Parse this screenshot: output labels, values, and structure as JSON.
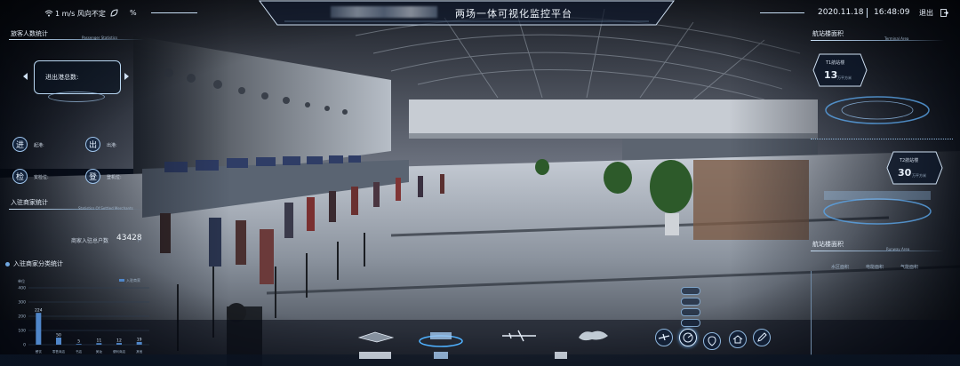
{
  "header": {
    "weather_wind": "1 m/s 风向不定",
    "humidity_unit": "%",
    "title": "两场一体可视化监控平台",
    "date": "2020.11.18",
    "time": "16:48:09",
    "logout_label": "退出"
  },
  "left_panel": {
    "passenger_stats": {
      "title": "旅客人数统计",
      "subtitle": "Passenger Statistics",
      "total_label": "进出港总数:",
      "rows": [
        {
          "icon_char": "进",
          "label": "起港:"
        },
        {
          "icon_char": "出",
          "label": "出港:"
        },
        {
          "icon_char": "检",
          "label": "安检位:"
        },
        {
          "icon_char": "登",
          "label": "登机位:"
        }
      ]
    },
    "merchant_stats": {
      "title": "入驻商家统计",
      "subtitle": "Statistics Of Settled Merchants",
      "count_label": "商家入驻总户数",
      "count_value": "43428",
      "count_unit": "户"
    },
    "merchant_category": {
      "title": "入驻商家分类统计",
      "legend_label": "入驻商家",
      "chart_data": {
        "type": "bar",
        "ylabel": "单位",
        "yticks": [
          400,
          300,
          200,
          100,
          0
        ],
        "ylim": [
          0,
          400
        ],
        "categories": [
          "餐饮",
          "零售商店",
          "书店",
          "美妆",
          "便利商店",
          "其他"
        ],
        "values": [
          224,
          50,
          5,
          11,
          12,
          19
        ]
      }
    }
  },
  "right_panel": {
    "terminal_area": {
      "title": "航站楼面积",
      "subtitle": "Terminal Area",
      "t1_label": "T1航站楼",
      "t1_value": "13",
      "t1_unit": "万平方米",
      "t2_label": "T2航站楼",
      "t2_value": "30",
      "t2_unit": "万平方米"
    },
    "runway_area": {
      "title": "航站楼面积",
      "subtitle": "Runway Area",
      "columns": [
        "水区面积",
        "电能面积",
        "气能面积"
      ]
    }
  },
  "colors": {
    "accent": "#7fb3e6",
    "bar": "#4f86c9",
    "panel_line": "#c8dff5",
    "background": "#0b1220"
  },
  "icons": [
    "wifi-icon",
    "leaf-icon",
    "logout-icon",
    "airplane-icon",
    "radar-icon",
    "location-icon",
    "home-icon",
    "edit-icon",
    "airport-model-icon",
    "terminal-model-icon",
    "plane-model-icon",
    "map-model-icon"
  ]
}
